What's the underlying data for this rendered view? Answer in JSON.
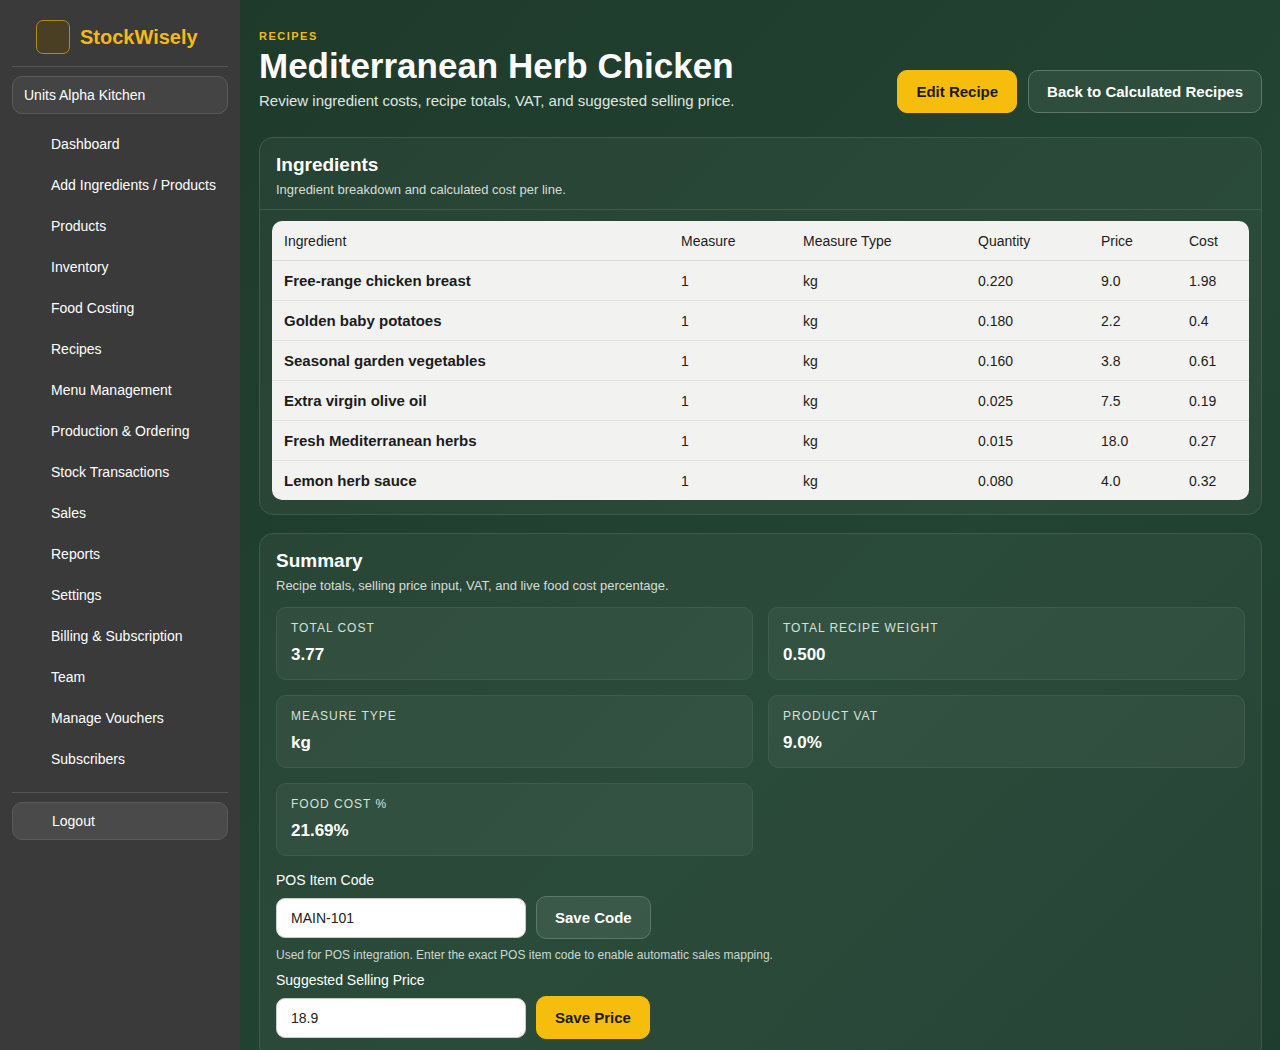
{
  "app": {
    "brand": "StockWisely",
    "workspace": "Units Alpha Kitchen"
  },
  "sidebar": {
    "items": [
      {
        "label": "Dashboard",
        "selected": false
      },
      {
        "label": "Add Ingredients / Products",
        "selected": false
      },
      {
        "label": "Products",
        "selected": false
      },
      {
        "label": "Inventory",
        "selected": false
      },
      {
        "label": "Food Costing",
        "selected": false
      },
      {
        "label": "Recipes",
        "selected": false
      },
      {
        "label": "Menu Management",
        "selected": false
      },
      {
        "label": "Production & Ordering",
        "selected": false
      },
      {
        "label": "Stock Transactions",
        "selected": false
      },
      {
        "label": "Sales",
        "selected": false
      },
      {
        "label": "Reports",
        "selected": false
      },
      {
        "label": "Settings",
        "selected": false
      },
      {
        "label": "Billing & Subscription",
        "selected": false
      },
      {
        "label": "Team",
        "selected": false
      },
      {
        "label": "Manage Vouchers",
        "selected": false
      },
      {
        "label": "Subscribers",
        "selected": false
      }
    ],
    "logout": "Logout"
  },
  "header": {
    "eyebrow": "RECIPES",
    "title": "Mediterranean Herb Chicken",
    "subtitle": "Review ingredient costs, recipe totals, VAT, and suggested selling price.",
    "buttons": [
      "Edit Recipe",
      "Back to Calculated Recipes"
    ]
  },
  "ingredients": {
    "title": "Ingredients",
    "subtitle": "Ingredient breakdown and calculated cost per line.",
    "columns": [
      "Ingredient",
      "Measure",
      "Measure Type",
      "Quantity",
      "Price",
      "Cost"
    ],
    "rows": [
      [
        "Free-range chicken breast",
        "1",
        "kg",
        "0.220",
        "9.0",
        "1.98"
      ],
      [
        "Golden baby potatoes",
        "1",
        "kg",
        "0.180",
        "2.2",
        "0.4"
      ],
      [
        "Seasonal garden vegetables",
        "1",
        "kg",
        "0.160",
        "3.8",
        "0.61"
      ],
      [
        "Extra virgin olive oil",
        "1",
        "kg",
        "0.025",
        "7.5",
        "0.19"
      ],
      [
        "Fresh Mediterranean herbs",
        "1",
        "kg",
        "0.015",
        "18.0",
        "0.27"
      ],
      [
        "Lemon herb sauce",
        "1",
        "kg",
        "0.080",
        "4.0",
        "0.32"
      ]
    ]
  },
  "summary": {
    "title": "Summary",
    "subtitle": "Recipe totals, selling price input, VAT, and live food cost percentage.",
    "stats": [
      {
        "label": "TOTAL COST",
        "value": "3.77"
      },
      {
        "label": "TOTAL RECIPE WEIGHT",
        "value": "0.500"
      },
      {
        "label": "MEASURE TYPE",
        "value": "kg"
      },
      {
        "label": "PRODUCT VAT",
        "value": "9.0%"
      },
      {
        "label": "FOOD COST %",
        "value": "21.69%"
      }
    ],
    "pos": {
      "label": "POS Item Code",
      "value": "MAIN-101",
      "button": "Save Code",
      "help": "Used for POS integration. Enter the exact POS item code to enable automatic sales mapping."
    },
    "price": {
      "label": "Suggested Selling Price",
      "value": "18.9",
      "button": "Save Price"
    }
  }
}
